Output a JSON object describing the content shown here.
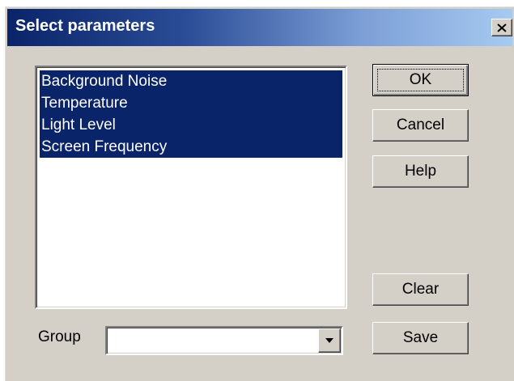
{
  "dialog": {
    "title": "Select parameters",
    "close_icon": "close-icon"
  },
  "parameters": {
    "items": [
      {
        "label": "Background Noise",
        "selected": true
      },
      {
        "label": "Temperature",
        "selected": true
      },
      {
        "label": "Light Level",
        "selected": true
      },
      {
        "label": "Screen Frequency",
        "selected": true
      }
    ]
  },
  "buttons": {
    "ok": "OK",
    "cancel": "Cancel",
    "help": "Help",
    "clear": "Clear",
    "save": "Save"
  },
  "group": {
    "label": "Group",
    "value": "",
    "dropdown_icon": "chevron-down-icon"
  },
  "colors": {
    "titlebar_start": "#0a246a",
    "titlebar_end": "#a6caf0",
    "selection": "#0a246a",
    "face": "#d4d0c8"
  }
}
